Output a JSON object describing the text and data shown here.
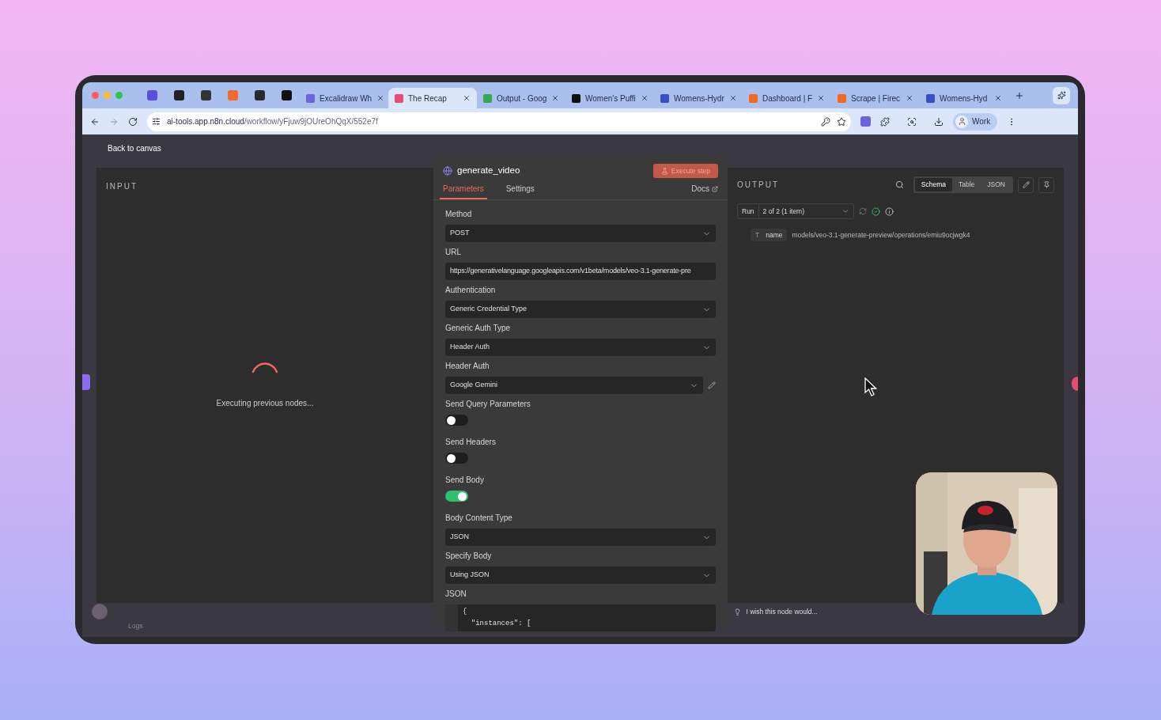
{
  "browser": {
    "pinned_tabs": [
      {
        "selected": false,
        "color": "#5b4fe0"
      },
      {
        "selected": false,
        "color": "#222222"
      },
      {
        "selected": false,
        "color": "#333333"
      },
      {
        "selected": false,
        "color": "#f06a2c"
      },
      {
        "selected": false,
        "color": "#2a2a2a"
      },
      {
        "selected": false,
        "color": "#111111"
      }
    ],
    "tabs": [
      {
        "title": "Excalidraw Wh",
        "selected": false,
        "color": "#6965db"
      },
      {
        "title": "The Recap",
        "selected": true,
        "color": "#ea4b71"
      },
      {
        "title": "Output - Goog",
        "selected": false,
        "color": "#34a853"
      },
      {
        "title": "Women's Puffi",
        "selected": false,
        "color": "#111111"
      },
      {
        "title": "Womens-Hydr",
        "selected": false,
        "color": "#3b4fc4"
      },
      {
        "title": "Dashboard | F",
        "selected": false,
        "color": "#f26b1d"
      },
      {
        "title": "Scrape | Firec",
        "selected": false,
        "color": "#f26b1d"
      },
      {
        "title": "Womens-Hyd",
        "selected": false,
        "color": "#3b4fc4"
      }
    ],
    "host": "ai-tools.app.n8n.cloud",
    "path": "/workflow/yFjuw9jOUreOhQqX/552e7f",
    "profile": "Work"
  },
  "back_link": "Back to canvas",
  "input": {
    "title": "INPUT",
    "status": "Executing previous nodes..."
  },
  "node": {
    "title": "generate_video",
    "execute_button": "Execute step",
    "tabs": [
      {
        "label": "Parameters",
        "selected": true
      },
      {
        "label": "Settings",
        "selected": false
      }
    ],
    "docs": "Docs",
    "fields": [
      {
        "kind": "select",
        "label": "Method",
        "value": "POST"
      },
      {
        "kind": "text",
        "label": "URL",
        "value": "https://generativelanguage.googleapis.com/v1beta/models/veo-3.1-generate-pre"
      },
      {
        "kind": "select",
        "label": "Authentication",
        "value": "Generic Credential Type"
      },
      {
        "kind": "select",
        "label": "Generic Auth Type",
        "value": "Header Auth"
      },
      {
        "kind": "credential",
        "label": "Header Auth",
        "value": "Google Gemini"
      },
      {
        "kind": "toggle",
        "label": "Send Query Parameters",
        "on": false
      },
      {
        "kind": "toggle",
        "label": "Send Headers",
        "on": false
      },
      {
        "kind": "toggle",
        "label": "Send Body",
        "on": true
      },
      {
        "kind": "select",
        "label": "Body Content Type",
        "value": "JSON"
      },
      {
        "kind": "select",
        "label": "Specify Body",
        "value": "Using JSON"
      },
      {
        "kind": "code",
        "label": "JSON",
        "lines": [
          "{",
          "  \"instances\": ["
        ]
      }
    ]
  },
  "output": {
    "title": "OUTPUT",
    "views": [
      {
        "label": "Schema",
        "selected": true
      },
      {
        "label": "Table",
        "selected": false
      },
      {
        "label": "JSON",
        "selected": false
      }
    ],
    "run_label": "Run",
    "run_value": "2 of 2 (1 item)",
    "schema": [
      {
        "type_icon": "T",
        "key": "name",
        "value": "models/veo-3.1-generate-preview/operations/emiu9ocjwgk4"
      }
    ]
  },
  "footer": {
    "logs": "Logs",
    "feedback": "I wish this node would..."
  }
}
